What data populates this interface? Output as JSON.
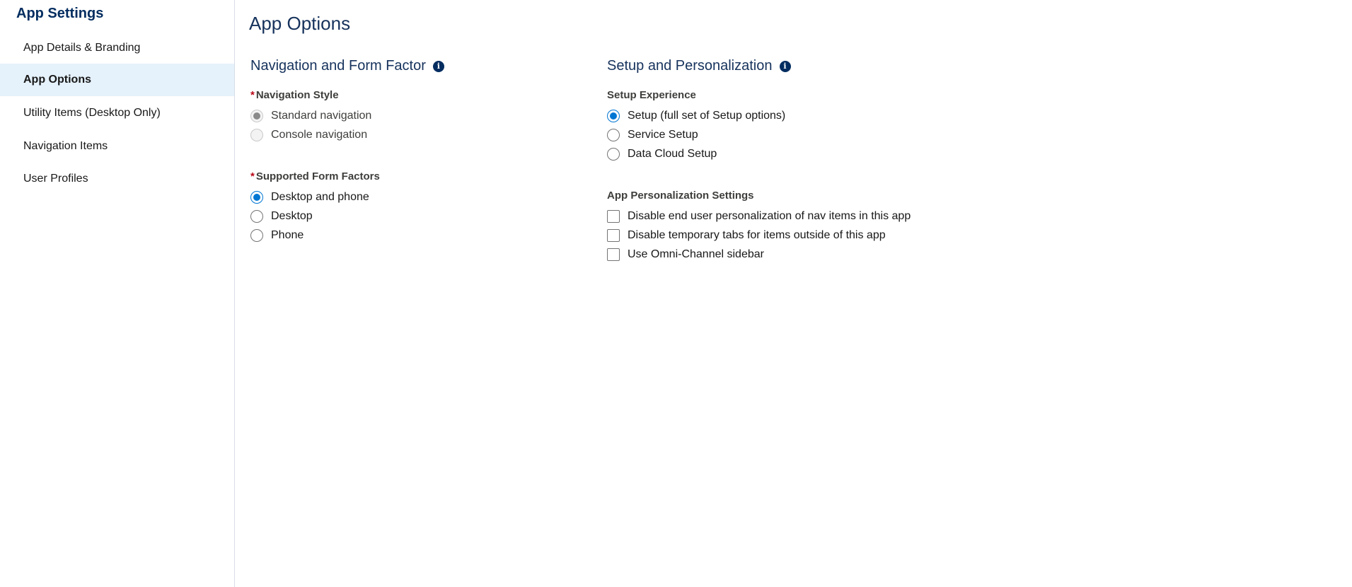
{
  "sidebar": {
    "title": "App Settings",
    "items": [
      {
        "label": "App Details & Branding"
      },
      {
        "label": "App Options"
      },
      {
        "label": "Utility Items (Desktop Only)"
      },
      {
        "label": "Navigation Items"
      },
      {
        "label": "User Profiles"
      }
    ],
    "active_index": 1
  },
  "main": {
    "page_title": "App Options",
    "left_section": {
      "title": "Navigation and Form Factor",
      "info_icon": "info-icon",
      "navigation_style": {
        "required_marker": "*",
        "label": "Navigation Style",
        "options": [
          {
            "label": "Standard navigation",
            "checked": true,
            "disabled": true
          },
          {
            "label": "Console navigation",
            "checked": false,
            "disabled": true
          }
        ]
      },
      "form_factors": {
        "required_marker": "*",
        "label": "Supported Form Factors",
        "options": [
          {
            "label": "Desktop and phone",
            "checked": true
          },
          {
            "label": "Desktop",
            "checked": false
          },
          {
            "label": "Phone",
            "checked": false
          }
        ]
      }
    },
    "right_section": {
      "title": "Setup and Personalization",
      "info_icon": "info-icon",
      "setup_experience": {
        "label": "Setup Experience",
        "options": [
          {
            "label": "Setup (full set of Setup options)",
            "checked": true
          },
          {
            "label": "Service Setup",
            "checked": false
          },
          {
            "label": "Data Cloud Setup",
            "checked": false
          }
        ]
      },
      "personalization": {
        "label": "App Personalization Settings",
        "options": [
          {
            "label": "Disable end user personalization of nav items in this app",
            "checked": false
          },
          {
            "label": "Disable temporary tabs for items outside of this app",
            "checked": false
          },
          {
            "label": "Use Omni-Channel sidebar",
            "checked": false
          }
        ]
      }
    }
  },
  "colors": {
    "accent": "#0176d3",
    "title": "#16325c",
    "brand_dark": "#032d60",
    "active_bg": "#e5f1fb",
    "required": "#ba0517"
  }
}
